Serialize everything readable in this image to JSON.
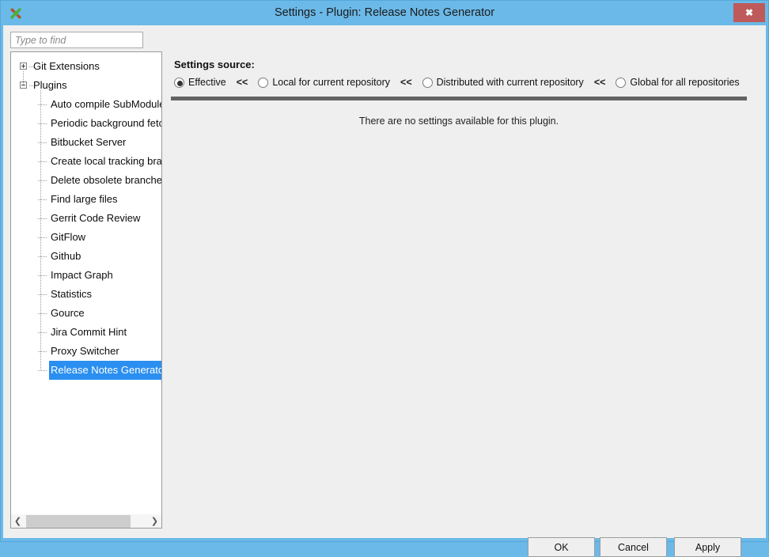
{
  "window": {
    "title": "Settings - Plugin: Release Notes Generator",
    "app_icon": "git-extensions-logo",
    "close_label": "✖",
    "frame_color": "#6bb9e8",
    "close_color": "#bf5a5a"
  },
  "search": {
    "placeholder": "Type to find",
    "value": ""
  },
  "tree": {
    "nodes": [
      {
        "label": "Git Extensions",
        "level": 0,
        "toggle": "plus",
        "selected": false
      },
      {
        "label": "Plugins",
        "level": 0,
        "toggle": "minus",
        "selected": false
      },
      {
        "label": "Auto compile SubModules",
        "level": 1,
        "toggle": "none",
        "selected": false
      },
      {
        "label": "Periodic background fetch",
        "level": 1,
        "toggle": "none",
        "selected": false
      },
      {
        "label": "Bitbucket Server",
        "level": 1,
        "toggle": "none",
        "selected": false
      },
      {
        "label": "Create local tracking branches",
        "level": 1,
        "toggle": "none",
        "selected": false
      },
      {
        "label": "Delete obsolete branches",
        "level": 1,
        "toggle": "none",
        "selected": false
      },
      {
        "label": "Find large files",
        "level": 1,
        "toggle": "none",
        "selected": false
      },
      {
        "label": "Gerrit Code Review",
        "level": 1,
        "toggle": "none",
        "selected": false
      },
      {
        "label": "GitFlow",
        "level": 1,
        "toggle": "none",
        "selected": false
      },
      {
        "label": "Github",
        "level": 1,
        "toggle": "none",
        "selected": false
      },
      {
        "label": "Impact Graph",
        "level": 1,
        "toggle": "none",
        "selected": false
      },
      {
        "label": "Statistics",
        "level": 1,
        "toggle": "none",
        "selected": false
      },
      {
        "label": "Gource",
        "level": 1,
        "toggle": "none",
        "selected": false
      },
      {
        "label": "Jira Commit Hint",
        "level": 1,
        "toggle": "none",
        "selected": false
      },
      {
        "label": "Proxy Switcher",
        "level": 1,
        "toggle": "none",
        "selected": false
      },
      {
        "label": "Release Notes Generator",
        "level": 1,
        "toggle": "none",
        "selected": true
      }
    ],
    "selection_color": "#2a8ff0",
    "scrollbar": {
      "left_arrow": "❮",
      "right_arrow": "❯"
    }
  },
  "settings_source": {
    "label": "Settings source:",
    "separator": "<<",
    "options": [
      {
        "label": "Effective",
        "checked": true
      },
      {
        "label": "Local for current repository",
        "checked": false
      },
      {
        "label": "Distributed with current repository",
        "checked": false
      },
      {
        "label": "Global for all repositories",
        "checked": false
      }
    ]
  },
  "content": {
    "empty_message": "There are no settings available for this plugin."
  },
  "buttons": {
    "ok": "OK",
    "cancel": "Cancel",
    "apply": "Apply"
  }
}
